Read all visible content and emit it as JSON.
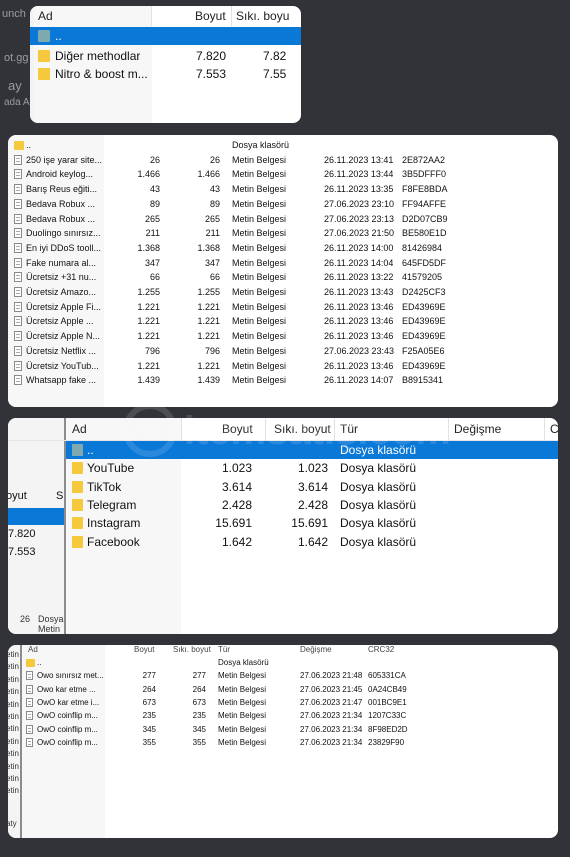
{
  "background_fragments": [
    "unch",
    "ot.gg",
    "ay",
    "ada A"
  ],
  "panel1": {
    "headers": {
      "name": "Ad",
      "size": "Boyut",
      "packed": "Sıkı. boyu"
    },
    "rows": [
      {
        "name": "..",
        "size": "",
        "packed": "",
        "selected": true
      },
      {
        "name": "Diğer methodlar",
        "size": "7.820",
        "packed": "7.82"
      },
      {
        "name": "Nitro & boost m...",
        "size": "7.553",
        "packed": "7.55"
      }
    ]
  },
  "panel2": {
    "rows": [
      {
        "name": "..",
        "size": "",
        "packed": "",
        "type": "Dosya klasörü",
        "modified": "",
        "crc": ""
      },
      {
        "name": "250 işe yarar site...",
        "size": "26",
        "packed": "26",
        "type": "Metin Belgesi",
        "modified": "26.11.2023 13:41",
        "crc": "2E872AA2"
      },
      {
        "name": "Android keylog...",
        "size": "1.466",
        "packed": "1.466",
        "type": "Metin Belgesi",
        "modified": "26.11.2023 13:44",
        "crc": "3B5DFFF0"
      },
      {
        "name": "Barış Reus eğiti...",
        "size": "43",
        "packed": "43",
        "type": "Metin Belgesi",
        "modified": "26.11.2023 13:35",
        "crc": "F8FE8BDA"
      },
      {
        "name": "Bedava Robux ...",
        "size": "89",
        "packed": "89",
        "type": "Metin Belgesi",
        "modified": "27.06.2023 23:10",
        "crc": "FF94AFFE"
      },
      {
        "name": "Bedava Robux ...",
        "size": "265",
        "packed": "265",
        "type": "Metin Belgesi",
        "modified": "27.06.2023 23:13",
        "crc": "D2D07CB9"
      },
      {
        "name": "Duolingo sınırsız...",
        "size": "211",
        "packed": "211",
        "type": "Metin Belgesi",
        "modified": "27.06.2023 21:50",
        "crc": "BE580E1D"
      },
      {
        "name": "En iyi DDoS tooll...",
        "size": "1.368",
        "packed": "1.368",
        "type": "Metin Belgesi",
        "modified": "26.11.2023 14:00",
        "crc": "81426984"
      },
      {
        "name": "Fake numara al...",
        "size": "347",
        "packed": "347",
        "type": "Metin Belgesi",
        "modified": "26.11.2023 14:04",
        "crc": "645FD5DF"
      },
      {
        "name": "Ücretsiz +31 nu...",
        "size": "66",
        "packed": "66",
        "type": "Metin Belgesi",
        "modified": "26.11.2023 13:22",
        "crc": "41579205"
      },
      {
        "name": "Ücretsiz Amazo...",
        "size": "1.255",
        "packed": "1.255",
        "type": "Metin Belgesi",
        "modified": "26.11.2023 13:43",
        "crc": "D2425CF3"
      },
      {
        "name": "Ücretsiz Apple Fi...",
        "size": "1.221",
        "packed": "1.221",
        "type": "Metin Belgesi",
        "modified": "26.11.2023 13:46",
        "crc": "ED43969E"
      },
      {
        "name": "Ücretsiz Apple ...",
        "size": "1.221",
        "packed": "1.221",
        "type": "Metin Belgesi",
        "modified": "26.11.2023 13:46",
        "crc": "ED43969E"
      },
      {
        "name": "Ücretsiz Apple N...",
        "size": "1.221",
        "packed": "1.221",
        "type": "Metin Belgesi",
        "modified": "26.11.2023 13:46",
        "crc": "ED43969E"
      },
      {
        "name": "Ücretsiz Netflix ...",
        "size": "796",
        "packed": "796",
        "type": "Metin Belgesi",
        "modified": "27.06.2023 23:43",
        "crc": "F25A05E6"
      },
      {
        "name": "Ücretsiz YouTub...",
        "size": "1.221",
        "packed": "1.221",
        "type": "Metin Belgesi",
        "modified": "26.11.2023 13:46",
        "crc": "ED43969E"
      },
      {
        "name": "Whatsapp fake ...",
        "size": "1.439",
        "packed": "1.439",
        "type": "Metin Belgesi",
        "modified": "26.11.2023 14:07",
        "crc": "B8915341"
      }
    ]
  },
  "panel3": {
    "headers": {
      "name": "Ad",
      "size": "Boyut",
      "packed": "Sıkı. boyut",
      "type": "Tür",
      "modified": "Değişme",
      "extra": "C"
    },
    "side_header": {
      "size": "oyut",
      "extra": "S"
    },
    "side_values": [
      "7.820",
      "7.553"
    ],
    "side_bottom": {
      "size": "26",
      "type": "Dosya",
      "name": "Metin"
    },
    "rows": [
      {
        "name": "..",
        "size": "",
        "packed": "",
        "type": "Dosya klasörü",
        "selected": true
      },
      {
        "name": "YouTube",
        "size": "1.023",
        "packed": "1.023",
        "type": "Dosya klasörü"
      },
      {
        "name": "TikTok",
        "size": "3.614",
        "packed": "3.614",
        "type": "Dosya klasörü"
      },
      {
        "name": "Telegram",
        "size": "2.428",
        "packed": "2.428",
        "type": "Dosya klasörü"
      },
      {
        "name": "Instagram",
        "size": "15.691",
        "packed": "15.691",
        "type": "Dosya klasörü"
      },
      {
        "name": "Facebook",
        "size": "1.642",
        "packed": "1.642",
        "type": "Dosya klasörü"
      }
    ],
    "watermark": "itemsatış.com"
  },
  "panel4": {
    "headers": {
      "name": "Ad",
      "size": "Boyut",
      "packed": "Sıkı. boyut",
      "type": "Tür",
      "modified": "Değişme",
      "crc": "CRC32"
    },
    "side_items": [
      "etin",
      "etin",
      "etin",
      "etin",
      "etin",
      "etin",
      "etin",
      "etin",
      "etin",
      "etin",
      "etin",
      "etin"
    ],
    "side_bottom": "aty",
    "rows": [
      {
        "name": "..",
        "size": "",
        "packed": "",
        "type": "Dosya klasörü",
        "modified": "",
        "crc": ""
      },
      {
        "name": "Owo sınırsız met...",
        "size": "277",
        "packed": "277",
        "type": "Metin Belgesi",
        "modified": "27.06.2023 21:48",
        "crc": "605331CA"
      },
      {
        "name": "Owo kar etme ...",
        "size": "264",
        "packed": "264",
        "type": "Metin Belgesi",
        "modified": "27.06.2023 21:45",
        "crc": "0A24CB49"
      },
      {
        "name": "OwO kar etme i...",
        "size": "673",
        "packed": "673",
        "type": "Metin Belgesi",
        "modified": "27.06.2023 21:47",
        "crc": "001BC9E1"
      },
      {
        "name": "OwO coinflip m...",
        "size": "235",
        "packed": "235",
        "type": "Metin Belgesi",
        "modified": "27.06.2023 21:34",
        "crc": "1207C33C"
      },
      {
        "name": "OwO coinflip m...",
        "size": "345",
        "packed": "345",
        "type": "Metin Belgesi",
        "modified": "27.06.2023 21:34",
        "crc": "8F98ED2D"
      },
      {
        "name": "OwO coinflip m...",
        "size": "355",
        "packed": "355",
        "type": "Metin Belgesi",
        "modified": "27.06.2023 21:34",
        "crc": "23829F90"
      }
    ]
  },
  "colors": {
    "background": "#313338",
    "selection": "#0a78d7",
    "folder": "#f6c83c",
    "panel": "#ffffff"
  }
}
